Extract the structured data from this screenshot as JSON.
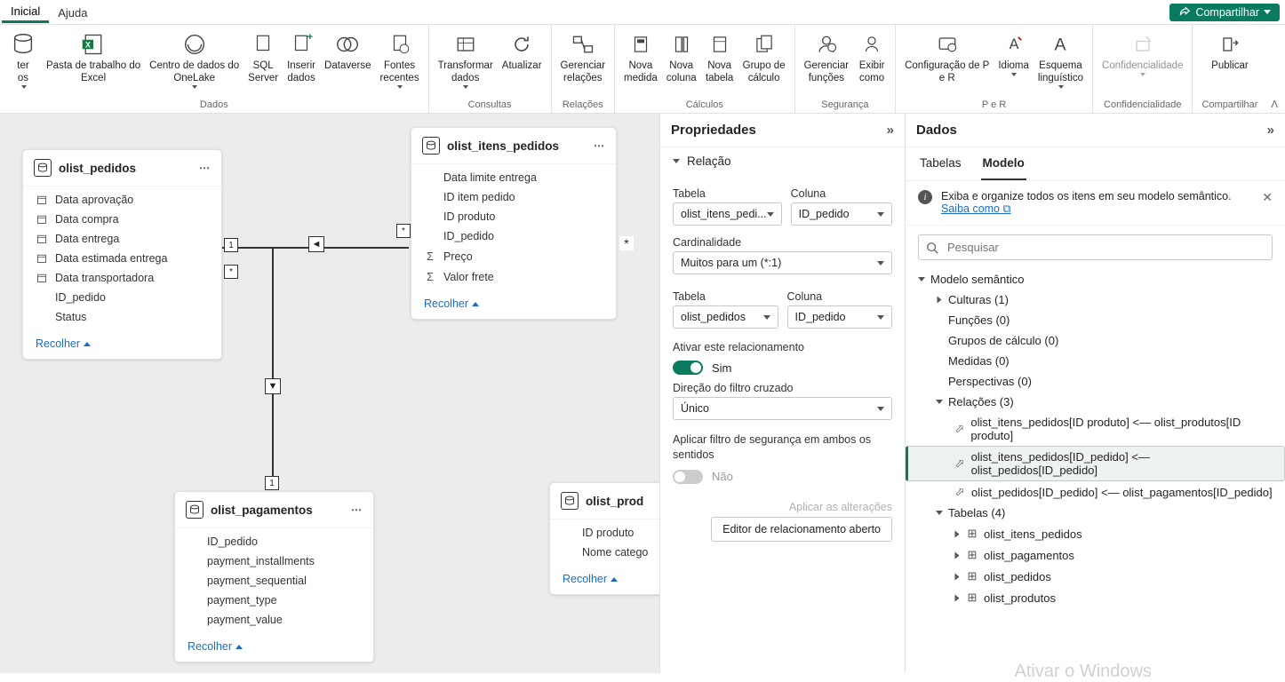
{
  "tabs": {
    "home": "Inicial",
    "help": "Ajuda",
    "share": "Compartilhar"
  },
  "ribbon": {
    "g_dados": "Dados",
    "g_consultas": "Consultas",
    "g_relacoes": "Relações",
    "g_calculos": "Cálculos",
    "g_seguranca": "Segurança",
    "g_per": "P e R",
    "g_confid": "Confidencialidade",
    "g_compart": "Compartilhar",
    "i_obter": "ter\nos",
    "i_excel": "Pasta de trabalho do\nExcel",
    "i_onelake": "Centro de dados do\nOneLake",
    "i_sql": "SQL\nServer",
    "i_inserir": "Inserir\ndados",
    "i_dataverse": "Dataverse",
    "i_fontes": "Fontes\nrecentes",
    "i_transformar": "Transformar\ndados",
    "i_atualizar": "Atualizar",
    "i_gerrel": "Gerenciar\nrelações",
    "i_medida": "Nova\nmedida",
    "i_coluna": "Nova\ncoluna",
    "i_tabela": "Nova\ntabela",
    "i_grupo": "Grupo de\ncálculo",
    "i_gerfunc": "Gerenciar\nfunções",
    "i_exibir": "Exibir\ncomo",
    "i_qa": "Configuração de P\ne R",
    "i_idioma": "Idioma",
    "i_esquema": "Esquema\nlinguístico",
    "i_conf": "Confidencialidade",
    "i_pub": "Publicar"
  },
  "tables": {
    "pedidos": {
      "name": "olist_pedidos",
      "fields": [
        "Data aprovação",
        "Data compra",
        "Data entrega",
        "Data estimada entrega",
        "Data transportadora",
        "ID_pedido",
        "Status"
      ],
      "icons": [
        "cal",
        "cal",
        "cal",
        "cal",
        "cal",
        "",
        ""
      ],
      "collapse": "Recolher"
    },
    "itens": {
      "name": "olist_itens_pedidos",
      "fields": [
        "Data limite entrega",
        "ID item pedido",
        "ID produto",
        "ID_pedido",
        "Preço",
        "Valor frete"
      ],
      "icons": [
        "",
        "",
        "",
        "",
        "sum",
        "sum"
      ],
      "collapse": "Recolher"
    },
    "pag": {
      "name": "olist_pagamentos",
      "fields": [
        "ID_pedido",
        "payment_installments",
        "payment_sequential",
        "payment_type",
        "payment_value"
      ],
      "icons": [
        "",
        "",
        "",
        "",
        ""
      ],
      "collapse": "Recolher"
    },
    "prod": {
      "name": "olist_prod",
      "fields": [
        "ID produto",
        "Nome catego"
      ],
      "icons": [
        "",
        ""
      ],
      "collapse": "Recolher"
    }
  },
  "props": {
    "title": "Propriedades",
    "section": "Relação",
    "tabela": "Tabela",
    "coluna": "Coluna",
    "t1": "olist_itens_pedi...",
    "c1": "ID_pedido",
    "card_lbl": "Cardinalidade",
    "card_val": "Muitos para um (*:1)",
    "t2": "olist_pedidos",
    "c2": "ID_pedido",
    "ativar": "Ativar este relacionamento",
    "sim": "Sim",
    "dir_lbl": "Direção do filtro cruzado",
    "dir_val": "Único",
    "aplicar_seg": "Aplicar filtro de segurança em ambos os sentidos",
    "nao": "Não",
    "aplicar_alt": "Aplicar as alterações",
    "editor": "Editor de relacionamento aberto"
  },
  "data": {
    "title": "Dados",
    "tab_tabelas": "Tabelas",
    "tab_modelo": "Modelo",
    "banner": "Exiba e organize todos os itens em seu modelo semântico.",
    "banner_link": "Saiba como",
    "search_ph": "Pesquisar",
    "modelo": "Modelo semântico",
    "culturas": "Culturas (1)",
    "funcoes": "Funções (0)",
    "grupos": "Grupos de cálculo (0)",
    "medidas": "Medidas (0)",
    "persp": "Perspectivas (0)",
    "relacoes": "Relações (3)",
    "rel1": "olist_itens_pedidos[ID produto] <— olist_produtos[ID produto]",
    "rel2": "olist_itens_pedidos[ID_pedido] <— olist_pedidos[ID_pedido]",
    "rel3": "olist_pedidos[ID_pedido] <— olist_pagamentos[ID_pedido]",
    "tabelas4": "Tabelas (4)",
    "tb1": "olist_itens_pedidos",
    "tb2": "olist_pagamentos",
    "tb3": "olist_pedidos",
    "tb4": "olist_produtos"
  },
  "watermark": "Ativar o Windows"
}
